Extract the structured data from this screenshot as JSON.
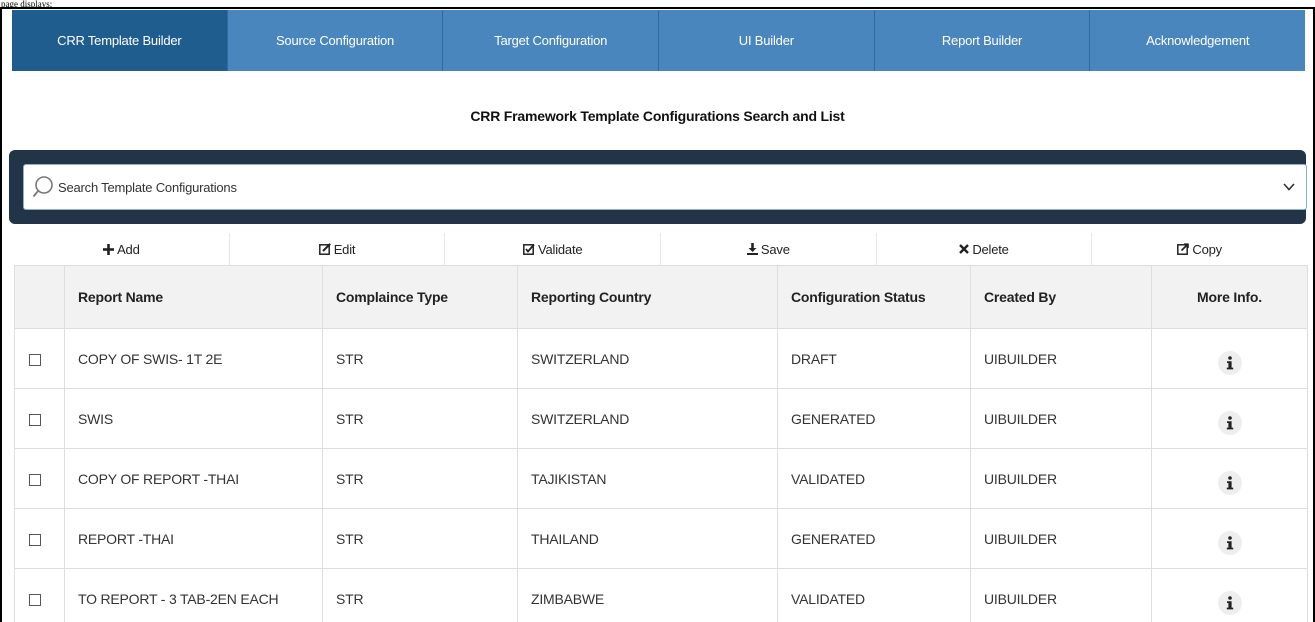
{
  "page_label": "page displays:",
  "nav": {
    "tabs": [
      {
        "label": "CRR Template Builder",
        "active": true
      },
      {
        "label": "Source Configuration",
        "active": false
      },
      {
        "label": "Target Configuration",
        "active": false
      },
      {
        "label": "UI Builder",
        "active": false
      },
      {
        "label": "Report Builder",
        "active": false
      },
      {
        "label": "Acknowledgement",
        "active": false
      }
    ]
  },
  "page_title": "CRR Framework Template Configurations Search and List",
  "search": {
    "placeholder": "Search Template Configurations",
    "icon": "search-icon",
    "dropdown_icon": "chevron-down-icon"
  },
  "toolbar": {
    "add": "Add",
    "edit": "Edit",
    "validate": "Validate",
    "save": "Save",
    "delete": "Delete",
    "copy": "Copy"
  },
  "table": {
    "headers": [
      "Report Name",
      "Complaince Type",
      "Reporting Country",
      "Configuration Status",
      "Created By",
      "More Info."
    ],
    "rows": [
      {
        "report_name": "COPY OF SWIS- 1T 2E",
        "compliance_type": "STR",
        "country": "SWITZERLAND",
        "status": "DRAFT",
        "created_by": "UIBUILDER"
      },
      {
        "report_name": "SWIS",
        "compliance_type": "STR",
        "country": "SWITZERLAND",
        "status": "GENERATED",
        "created_by": "UIBUILDER"
      },
      {
        "report_name": "COPY OF REPORT -THAI",
        "compliance_type": "STR",
        "country": "TAJIKISTAN",
        "status": "VALIDATED",
        "created_by": "UIBUILDER"
      },
      {
        "report_name": "REPORT -THAI",
        "compliance_type": "STR",
        "country": "THAILAND",
        "status": "GENERATED",
        "created_by": "UIBUILDER"
      },
      {
        "report_name": "TO REPORT - 3 TAB-2EN EACH",
        "compliance_type": "STR",
        "country": "ZIMBABWE",
        "status": "VALIDATED",
        "created_by": "UIBUILDER"
      }
    ]
  },
  "colors": {
    "nav_bg": "#4a86be",
    "nav_active": "#1f5d8e",
    "search_band": "#223447",
    "header_bg": "#f2f2f2"
  }
}
